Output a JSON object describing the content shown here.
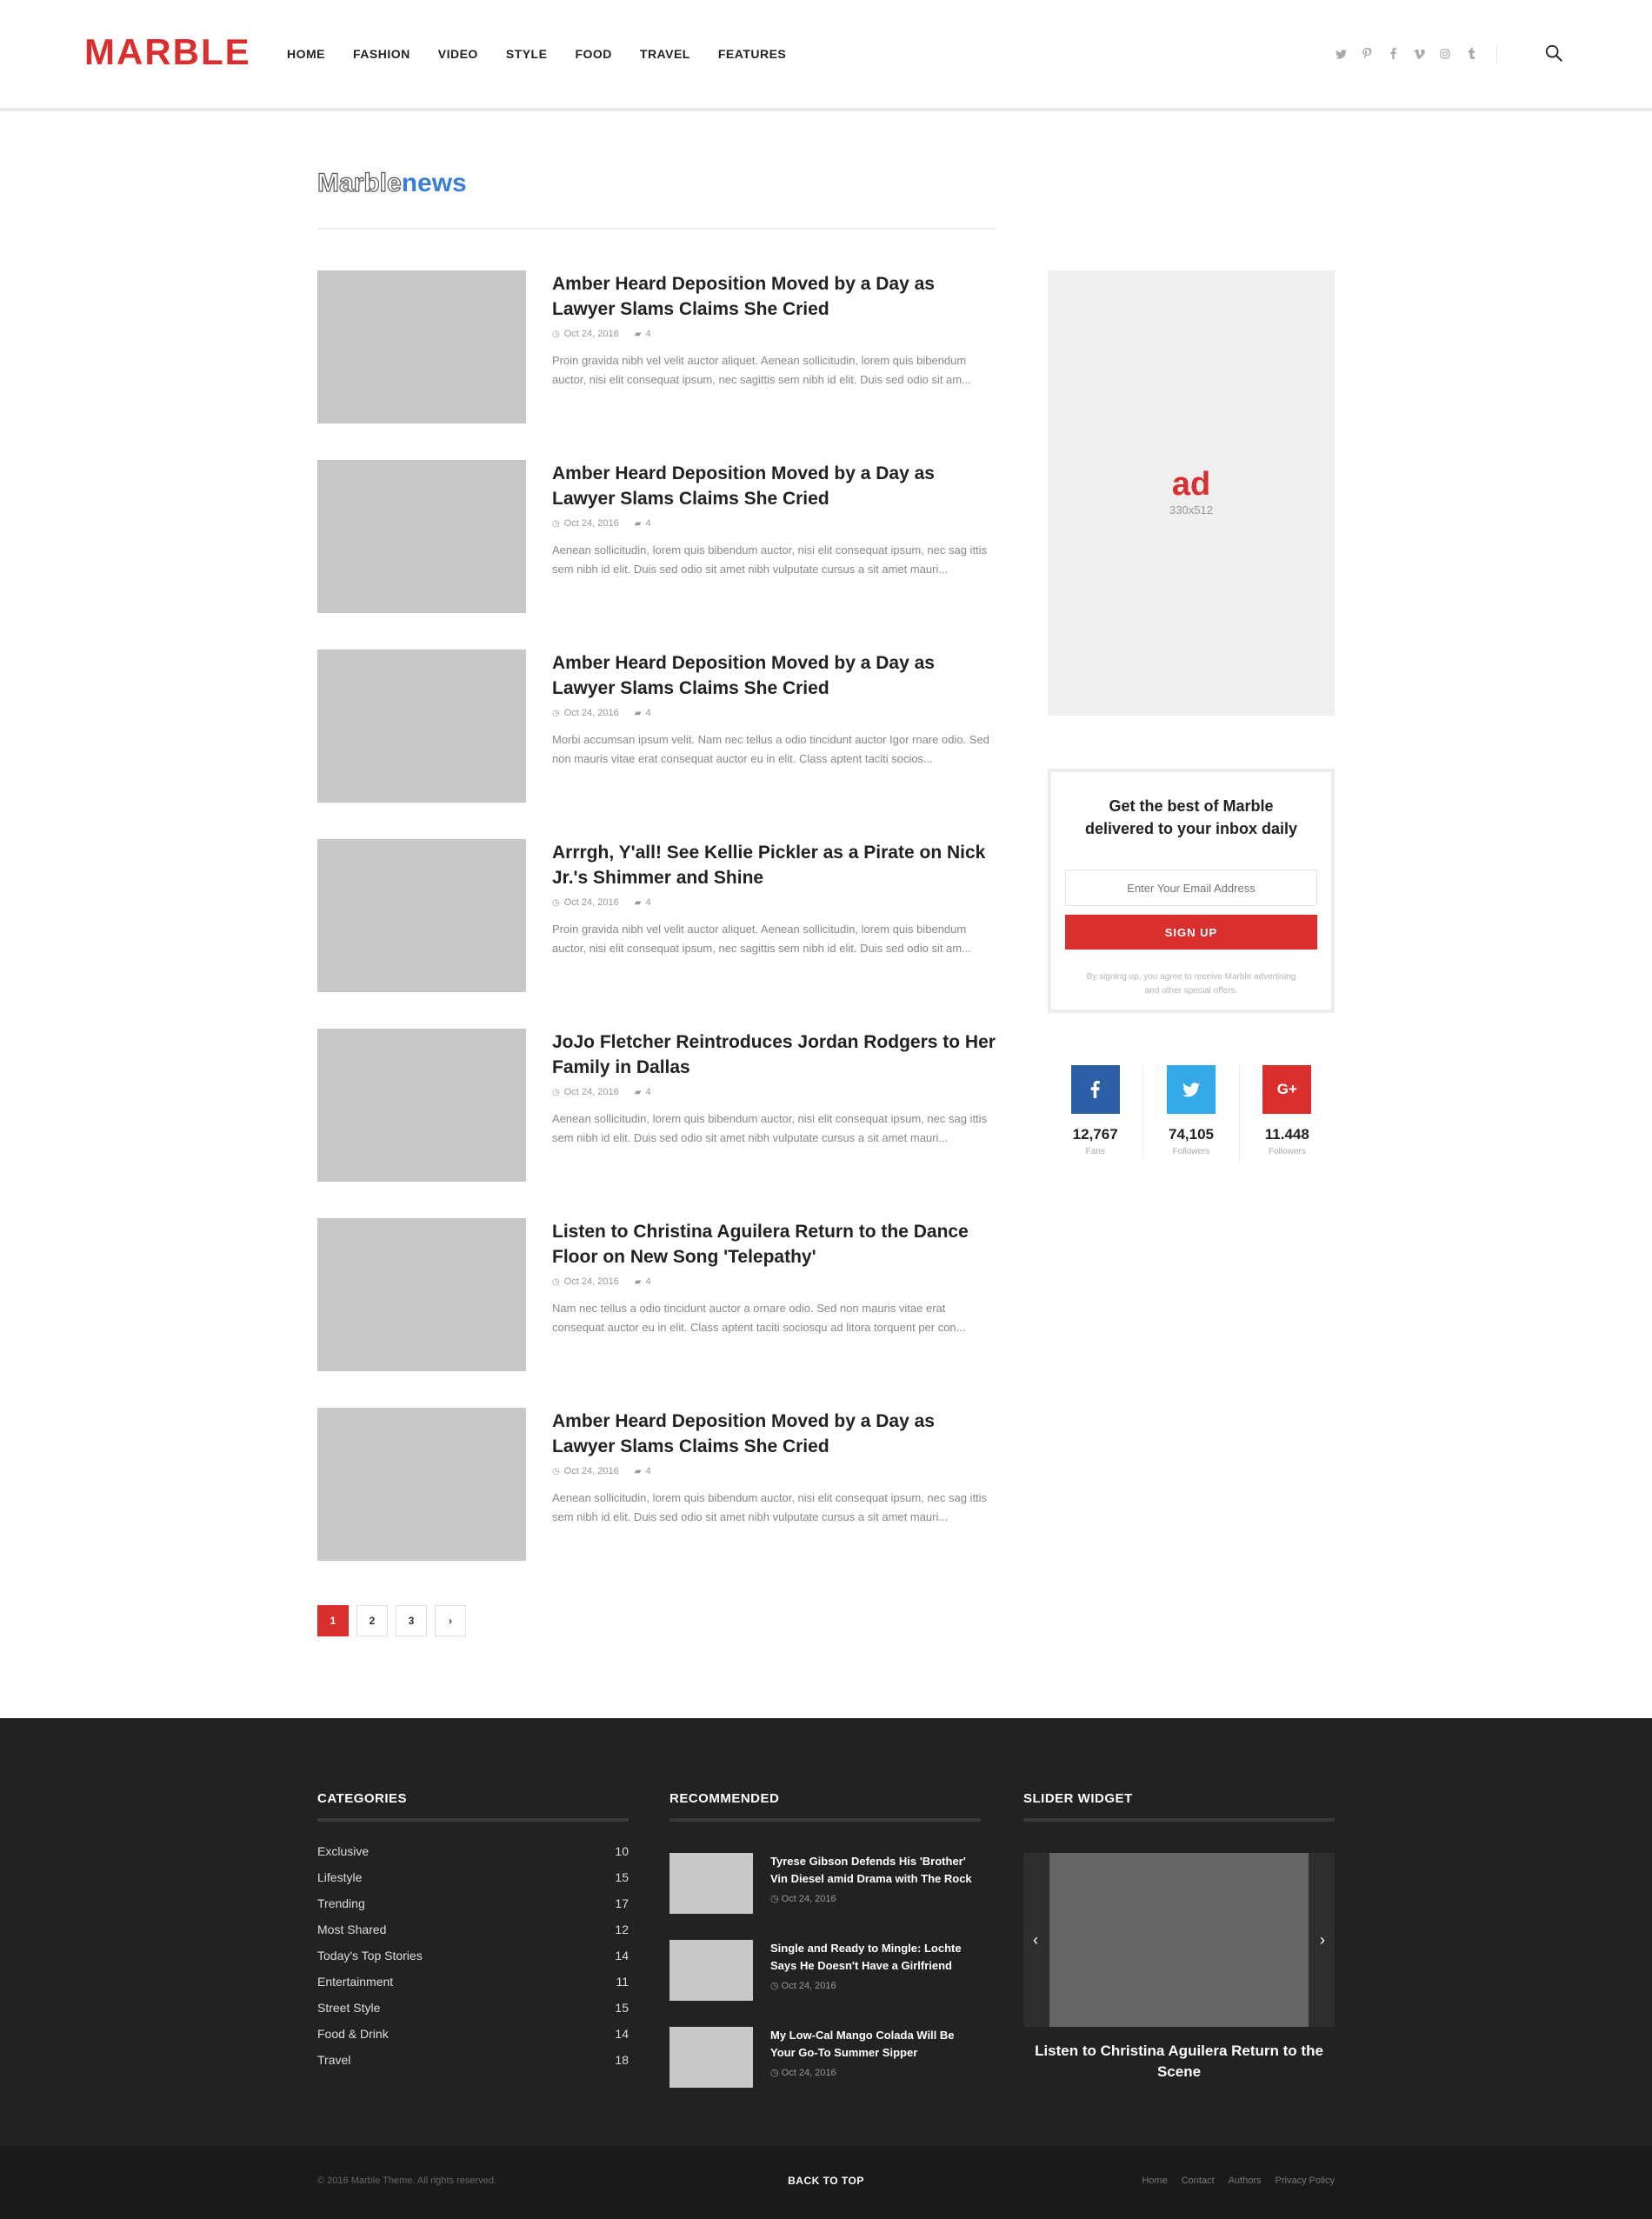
{
  "header": {
    "logo": "MARBLE",
    "nav": [
      "HOME",
      "FASHION",
      "VIDEO",
      "STYLE",
      "FOOD",
      "TRAVEL",
      "FEATURES"
    ],
    "social_icons": [
      "twitter-icon",
      "pinterest-icon",
      "facebook-icon",
      "vimeo-icon",
      "instagram-icon",
      "tumblr-icon"
    ]
  },
  "section": {
    "title_part1": "Marble",
    "title_part2": "news"
  },
  "articles": [
    {
      "title": "Amber Heard Deposition Moved by a Day as Lawyer Slams Claims She Cried",
      "date": "Oct 24, 2016",
      "comments": "4",
      "excerpt": "Proin gravida nibh vel velit auctor aliquet. Aenean sollicitudin, lorem quis bibendum auctor, nisi elit consequat ipsum, nec sagittis sem nibh id elit. Duis sed odio sit am..."
    },
    {
      "title": "Amber Heard Deposition Moved by a Day as Lawyer Slams Claims She Cried",
      "date": "Oct 24, 2016",
      "comments": "4",
      "excerpt": "Aenean sollicitudin, lorem quis bibendum auctor, nisi elit consequat ipsum, nec sag ittis sem nibh id elit. Duis sed odio sit amet nibh vulputate cursus a sit amet mauri..."
    },
    {
      "title": "Amber Heard Deposition Moved by a Day as Lawyer Slams Claims She Cried",
      "date": "Oct 24, 2016",
      "comments": "4",
      "excerpt": "Morbi accumsan ipsum velit. Nam nec tellus a odio tincidunt auctor Igor  rnare odio. Sed non  mauris vitae erat consequat auctor eu in elit. Class aptent taciti socios..."
    },
    {
      "title": "Arrrgh, Y'all! See Kellie Pickler as a Pirate on Nick Jr.'s Shimmer and Shine",
      "date": "Oct 24, 2016",
      "comments": "4",
      "excerpt": "Proin gravida nibh vel velit auctor aliquet. Aenean sollicitudin, lorem quis bibendum auctor, nisi elit consequat ipsum, nec sagittis sem nibh id elit. Duis sed odio sit am..."
    },
    {
      "title": "JoJo Fletcher Reintroduces Jordan Rodgers to Her Family in Dallas",
      "date": "Oct 24, 2016",
      "comments": "4",
      "excerpt": "Aenean sollicitudin, lorem quis bibendum auctor, nisi elit consequat ipsum, nec sag ittis sem nibh id elit. Duis sed odio sit amet nibh vulputate cursus a sit amet mauri..."
    },
    {
      "title": "Listen to Christina Aguilera Return to the Dance Floor on New Song 'Telepathy'",
      "date": "Oct 24, 2016",
      "comments": "4",
      "excerpt": "Nam nec tellus a odio tincidunt auctor a ornare odio. Sed non  mauris vitae erat consequat auctor eu in elit. Class aptent taciti sociosqu ad litora torquent per con..."
    },
    {
      "title": "Amber Heard Deposition Moved by a Day as Lawyer Slams Claims She Cried",
      "date": "Oct 24, 2016",
      "comments": "4",
      "excerpt": "Aenean sollicitudin, lorem quis bibendum auctor, nisi elit consequat ipsum, nec sag ittis sem nibh id elit. Duis sed odio sit amet nibh vulputate cursus a sit amet mauri..."
    }
  ],
  "pagination": {
    "pages": [
      "1",
      "2",
      "3"
    ],
    "active": "1",
    "next": "›"
  },
  "ad": {
    "label": "ad",
    "size": "330x512"
  },
  "newsletter": {
    "heading": "Get the best of Marble delivered to your inbox daily",
    "placeholder": "Enter Your Email Address",
    "button": "SIGN UP",
    "fine_print": "By signing up, you agree to receive Marble advertising and other special offers."
  },
  "social_counts": [
    {
      "icon": "facebook-icon",
      "glyph": "f",
      "count": "12,767",
      "label": "Fans",
      "color": "#2d5fa6"
    },
    {
      "icon": "twitter-icon",
      "glyph": "t",
      "count": "74,105",
      "label": "Followers",
      "color": "#35a9e8"
    },
    {
      "icon": "google-plus-icon",
      "glyph": "G+",
      "count": "11.448",
      "label": "Followers",
      "color": "#d9302f"
    }
  ],
  "footer": {
    "categories_title": "CATEGORIES",
    "categories": [
      {
        "name": "Exclusive",
        "count": "10"
      },
      {
        "name": "Lifestyle",
        "count": "15"
      },
      {
        "name": "Trending",
        "count": "17"
      },
      {
        "name": "Most Shared",
        "count": "12"
      },
      {
        "name": "Today's Top Stories",
        "count": "14"
      },
      {
        "name": "Entertainment",
        "count": "11"
      },
      {
        "name": "Street Style",
        "count": "15"
      },
      {
        "name": "Food & Drink",
        "count": "14"
      },
      {
        "name": "Travel",
        "count": "18"
      }
    ],
    "recommended_title": "RECOMMENDED",
    "recommended": [
      {
        "title": "Tyrese Gibson Defends His 'Brother' Vin Diesel amid Drama with The Rock",
        "date": "Oct 24, 2016"
      },
      {
        "title": "Single and Ready to Mingle: Lochte Says He Doesn't Have a Girlfriend",
        "date": "Oct 24, 2016"
      },
      {
        "title": "My Low-Cal Mango Colada Will Be Your Go-To Summer Sipper",
        "date": "Oct 24, 2016"
      }
    ],
    "slider_title": "SLIDER WIDGET",
    "slider_caption": "Listen to Christina Aguilera Return to the Scene"
  },
  "bottom_bar": {
    "copyright": "© 2016 Marble Theme. All rights reserved.",
    "back_to_top": "BACK TO TOP",
    "links": [
      "Home",
      "Contact",
      "Authors",
      "Privacy Policy"
    ]
  }
}
